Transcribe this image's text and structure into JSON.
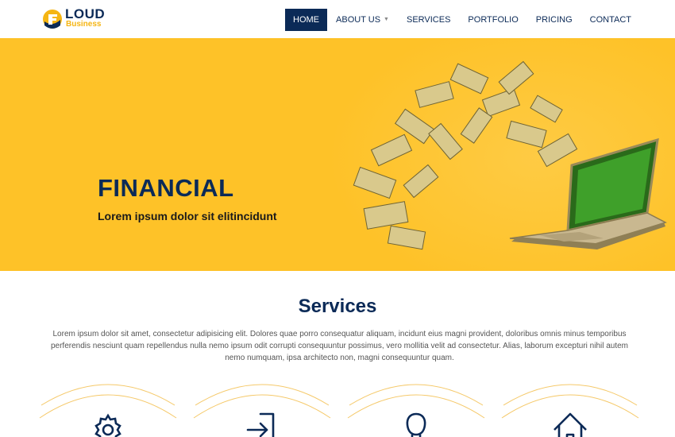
{
  "brand": {
    "word": "LOUD",
    "sub": "Business"
  },
  "nav": {
    "items": [
      {
        "label": "HOME",
        "active": true
      },
      {
        "label": "ABOUT US",
        "has_dropdown": true
      },
      {
        "label": "SERVICES"
      },
      {
        "label": "PORTFOLIO"
      },
      {
        "label": "PRICING"
      },
      {
        "label": "CONTACT"
      }
    ]
  },
  "hero": {
    "title": "FINANCIAL",
    "subtitle": "Lorem ipsum dolor sit elitincidunt",
    "image": "money-flying-from-laptop-illustration"
  },
  "services": {
    "title": "Services",
    "description": "Lorem ipsum dolor sit amet, consectetur adipisicing elit. Dolores quae porro consequatur aliquam, incidunt eius magni provident, doloribus omnis minus temporibus perferendis nesciunt quam repellendus nulla nemo ipsum odit corrupti consequuntur possimus, vero mollitia velit ad consectetur. Alias, laborum excepturi nihil autem nemo numquam, ipsa architecto non, magni consequuntur quam.",
    "cards": [
      {
        "icon": "gear-icon"
      },
      {
        "icon": "sign-in-icon"
      },
      {
        "icon": "user-icon"
      },
      {
        "icon": "home-icon"
      }
    ]
  },
  "colors": {
    "brand_navy": "#0b2a57",
    "brand_yellow": "#fec228",
    "logo_yellow": "#f5b513",
    "arc_color": "#f5c96a"
  }
}
